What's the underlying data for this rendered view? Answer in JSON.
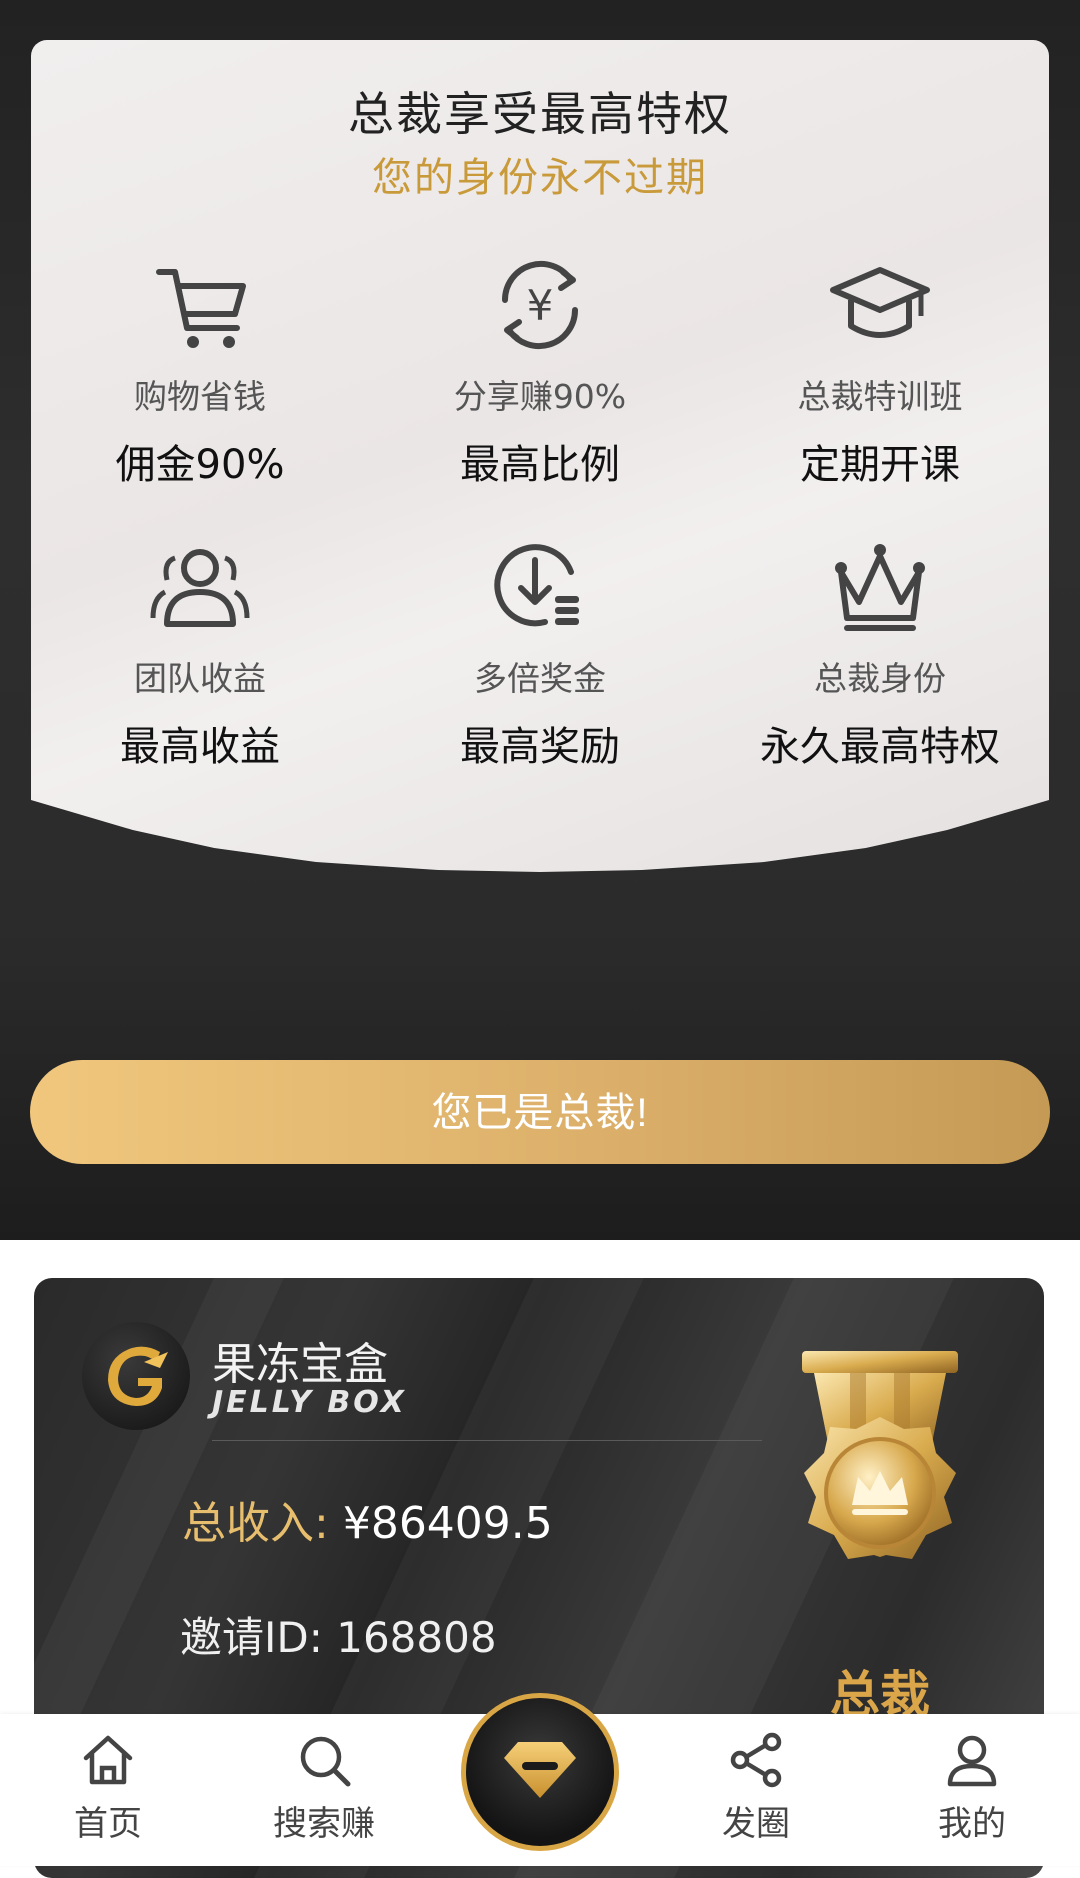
{
  "privileges": {
    "title": "总裁享受最高特权",
    "subtitle": "您的身份永不过期",
    "items": [
      {
        "icon": "shopping-cart-icon",
        "label": "购物省钱",
        "value": "佣金90%"
      },
      {
        "icon": "yuan-exchange-icon",
        "label": "分享赚90%",
        "value": "最高比例"
      },
      {
        "icon": "graduation-cap-icon",
        "label": "总裁特训班",
        "value": "定期开课"
      },
      {
        "icon": "team-icon",
        "label": "团队收益",
        "value": "最高收益"
      },
      {
        "icon": "download-coins-icon",
        "label": "多倍奖金",
        "value": "最高奖励"
      },
      {
        "icon": "crown-icon",
        "label": "总裁身份",
        "value": "永久最高特权"
      }
    ],
    "button_label": "您已是总裁!"
  },
  "member_card": {
    "brand_cn": "果冻宝盒",
    "brand_en": "JELLY BOX",
    "income_label": "总收入:",
    "income_value": "¥86409.5",
    "invite": "邀请ID: 168808",
    "rank": "总裁"
  },
  "nav": {
    "items": [
      {
        "label": "首页",
        "icon": "home-icon"
      },
      {
        "label": "搜索赚",
        "icon": "search-icon"
      },
      {
        "label": "",
        "icon": "diamond-icon"
      },
      {
        "label": "发圈",
        "icon": "share-icon"
      },
      {
        "label": "我的",
        "icon": "profile-icon"
      }
    ]
  },
  "colors": {
    "gold": "#c99a3a",
    "gold_light": "#f0c77d",
    "dark": "#2b2b2b"
  }
}
